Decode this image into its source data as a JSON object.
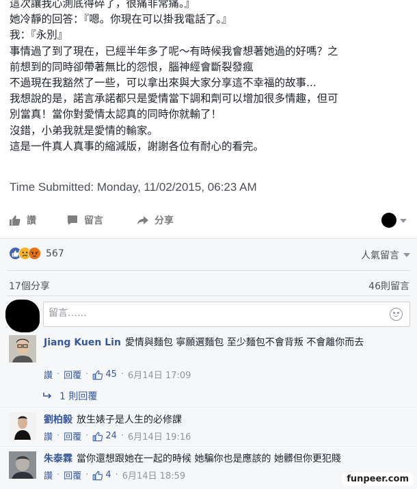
{
  "post": {
    "lines": [
      "這次讓我心測底得碎了，很痛非常痛。』",
      "她冷靜的回答：『嗯。你現在可以掛我電話了。』",
      "我：『永別』",
      "事情過了到了現在，已經半年多了呢～有時候我會想著她過的好嗎？之",
      "前想到的同時卻帶著無比的怨恨，腦神經會斷裂發瘋",
      "不過現在我豁然了一些，可以拿出來與大家分享這不幸福的故事...",
      "我想說的是，諾言承諾都只是愛情當下調和劑可以增加很多情趣，但可",
      "別當真！當你對愛情太認真的同時你就輸了！",
      "沒錯，小弟我就是愛情的輸家。",
      "這是一件真人真事的縮減版，謝謝各位有耐心的看完。"
    ],
    "time_submitted": "Time Submitted: Monday, 11/02/2015, 06:23 AM"
  },
  "actions": {
    "like": "讚",
    "comment": "留言",
    "share": "分享"
  },
  "reactions": {
    "count": "567",
    "sort_label": "人氣留言"
  },
  "stats": {
    "shares": "17個分享",
    "comments": "46則留言"
  },
  "composer": {
    "placeholder": "留言……"
  },
  "comments": [
    {
      "name": "Jiang Kuen Lin",
      "text": "愛情與麵包 寧願選麵包 至少麵包不會背叛 不會離你而去",
      "like": "讚",
      "reply": "回覆",
      "likes": "45",
      "date": "6月14日 17:09"
    },
    {
      "name": "劉柏毅",
      "text": "放生婊子是人生的必修課",
      "like": "讚",
      "reply": "回覆",
      "likes": "24",
      "date": "6月14日 19:16"
    },
    {
      "name": "朱泰霖",
      "text": "當你還想跟她在一起的時候 她騙你也是應該的 她髒但你更犯賤",
      "like": "讚",
      "reply": "回覆",
      "likes": "4",
      "date": "6月14日 18:59"
    }
  ],
  "reply_link": "1 則回覆",
  "meta_separator": "·",
  "watermark": "funpeer.com",
  "colors": {
    "link": "#365899",
    "like_blue": "#4267b2",
    "love_red": "#f25268",
    "sad_yellow": "#f7b125",
    "angry_orange": "#e9710f",
    "panel_bg": "#f6f7f9"
  }
}
